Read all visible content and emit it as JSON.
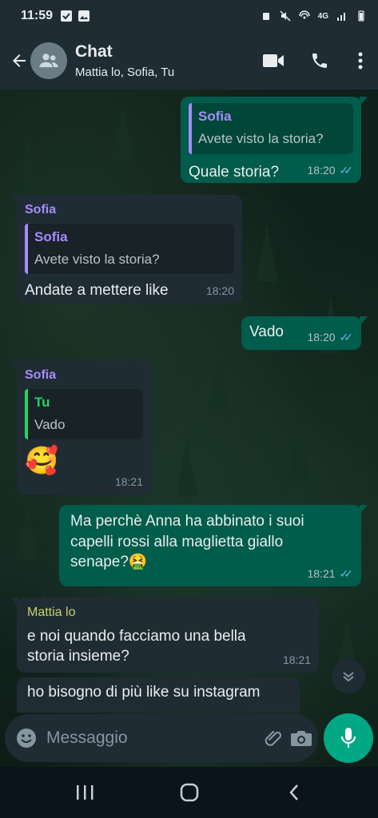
{
  "status_bar": {
    "time": "11:59",
    "network": "4G"
  },
  "header": {
    "title": "Chat",
    "subtitle": "Mattia lo, Sofia, Tu"
  },
  "messages": [
    {
      "direction": "out",
      "quote_author": "Sofia",
      "quote_text": "Avete visto la storia?",
      "text": "Quale storia?",
      "time": "18:20",
      "status": "read"
    },
    {
      "direction": "in",
      "sender": "Sofia",
      "quote_author": "Sofia",
      "quote_text": "Avete visto la storia?",
      "text": "Andate a mettere like",
      "time": "18:20"
    },
    {
      "direction": "out",
      "text": "Vado",
      "time": "18:20",
      "status": "read"
    },
    {
      "direction": "in",
      "sender": "Sofia",
      "quote_author": "Tu",
      "quote_text": "Vado",
      "text": "🥰",
      "time": "18:21"
    },
    {
      "direction": "out",
      "text": "Ma perchè Anna ha abbinato i suoi capelli rossi alla maglietta giallo senape?🤮",
      "time": "18:21",
      "status": "read"
    },
    {
      "direction": "in",
      "sender": "Mattia lo",
      "text": "e noi quando facciamo una bella storia insieme?",
      "time": "18:21"
    },
    {
      "direction": "in",
      "text": "ho bisogno di più like su instagram"
    }
  ],
  "input": {
    "placeholder": "Messaggio"
  },
  "colors": {
    "outgoing_bubble": "#005c4b",
    "incoming_bubble": "#202c33",
    "accent": "#00a884",
    "read_ticks": "#53bdeb",
    "sofia_name": "#a78bfa",
    "tu_name": "#25d366",
    "mattia_name": "#c8d26b"
  },
  "icons": [
    "back-arrow-icon",
    "group-avatar-icon",
    "video-call-icon",
    "phone-icon",
    "more-vert-icon",
    "emoji-icon",
    "attach-icon",
    "camera-icon",
    "mic-icon",
    "chevron-down-icon"
  ]
}
